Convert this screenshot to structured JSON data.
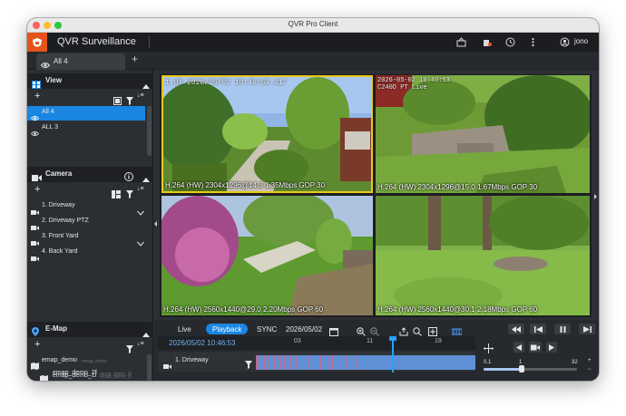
{
  "window": {
    "title": "QVR Pro Client"
  },
  "app": {
    "title": "QVR Surveillance",
    "user": "jono"
  },
  "tabs": [
    {
      "label": "All 4"
    }
  ],
  "colors": {
    "accent": "#1a86e2",
    "logo": "#e2541a",
    "selected_cam_border": "#e8c91a"
  },
  "sidebar": {
    "view": {
      "title": "View",
      "items": [
        {
          "label": "All 4",
          "selected": true
        },
        {
          "label": "ALL 3",
          "selected": false
        }
      ]
    },
    "camera": {
      "title": "Camera",
      "items": [
        {
          "label": "1. Driveway",
          "expandable": true
        },
        {
          "label": "2. Driveway PTZ",
          "expandable": false
        },
        {
          "label": "3. Front Yard",
          "expandable": true
        },
        {
          "label": "4. Back Yard",
          "expandable": false
        }
      ]
    },
    "emap": {
      "title": "E-Map",
      "items": [
        {
          "label": "emap_demo",
          "sub": "emap_demo"
        },
        {
          "label": "emap_demo_1f",
          "sub": "emap_demo_1f"
        },
        {
          "label": "emap_demo_2f",
          "sub": "emap_demo_2f"
        }
      ]
    }
  },
  "cameras": [
    {
      "timestamp": "1.0X  2026/05/02 10:46:53.317",
      "info": "H.264 (HW) 2304x1296@14.3 1.35Mbps  GOP 30"
    },
    {
      "timestamp": "2026-05-02 10:46:53\nC240D PT Live",
      "info": "H.264 (HW) 2304x1296@15.0 1.67Mbps  GOP 30"
    },
    {
      "timestamp": "",
      "info": "H.264 (HW) 2560x1440@29.0 2.20Mbps  GOP 60"
    },
    {
      "timestamp": "",
      "info": "H.264 (HW) 2560x1440@30.1 2.18Mbps  GOP 60"
    }
  ],
  "playback": {
    "live_label": "Live",
    "playback_label": "Playback",
    "sync_label": "SYNC",
    "date": "2026/05/02",
    "current_time": "2026/05/02 10:46:53",
    "ticks": [
      "03",
      "11",
      "19"
    ],
    "row_label": "1. Driveway",
    "speed_min": "0.1",
    "speed_mid": "1",
    "speed_max": "32"
  }
}
